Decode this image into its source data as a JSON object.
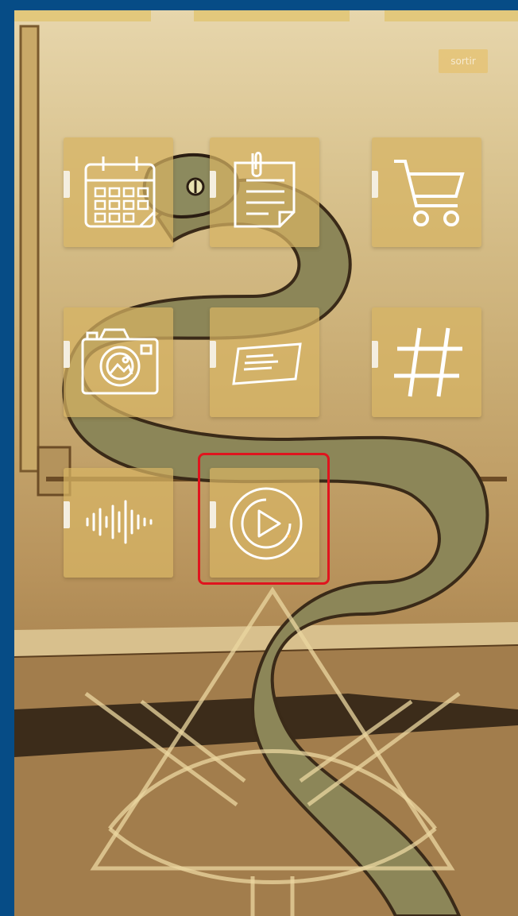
{
  "header": {
    "exit_label": "sortir"
  },
  "apps": [
    {
      "icon": "calendar-icon"
    },
    {
      "icon": "notes-icon"
    },
    {
      "icon": "cart-icon"
    },
    {
      "icon": "camera-icon"
    },
    {
      "icon": "card-icon"
    },
    {
      "icon": "hashtag-icon"
    },
    {
      "icon": "audio-wave-icon"
    },
    {
      "icon": "play-icon",
      "highlighted": true
    }
  ],
  "colors": {
    "outer_frame": "#064c86",
    "tile": "#d7b464",
    "highlight": "#e0141e",
    "icon_stroke": "#ffffff"
  }
}
